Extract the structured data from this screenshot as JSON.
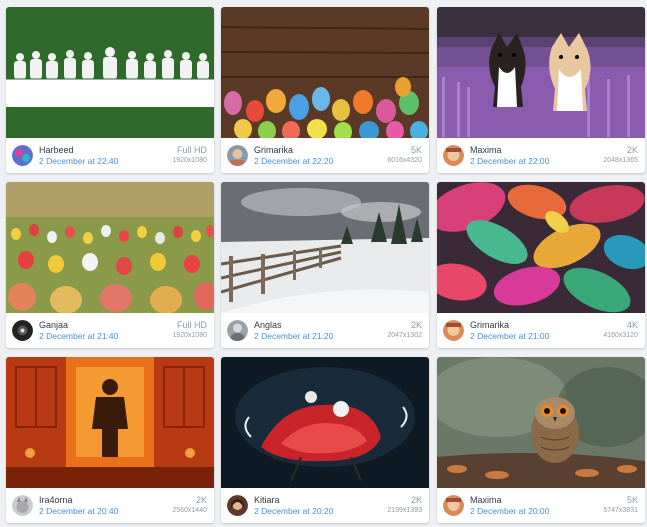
{
  "wallpapers": [
    {
      "author": "Harbeed",
      "date": "2 December at 22:40",
      "resolution_label": "Full HD",
      "dimensions": "1920x1080",
      "thumbnail": "last-supper-icon",
      "avatar": "colorful-avatar-icon"
    },
    {
      "author": "Grimarika",
      "date": "2 December at 22:20",
      "resolution_label": "5K",
      "dimensions": "6016x4320",
      "thumbnail": "easter-eggs-icon",
      "avatar": "person-avatar-icon"
    },
    {
      "author": "Maxima",
      "date": "2 December at 22:00",
      "resolution_label": "2K",
      "dimensions": "2048x1365",
      "thumbnail": "dogs-lavender-icon",
      "avatar": "face-avatar-icon"
    },
    {
      "author": "Ganjaa",
      "date": "2 December at 21:40",
      "resolution_label": "Full HD",
      "dimensions": "1920x1080",
      "thumbnail": "tulips-field-icon",
      "avatar": "dark-avatar-icon"
    },
    {
      "author": "Anglas",
      "date": "2 December at 21:20",
      "resolution_label": "2K",
      "dimensions": "2047x1302",
      "thumbnail": "snowy-fence-icon",
      "avatar": "grey-avatar-icon"
    },
    {
      "author": "Grimarika",
      "date": "2 December at 21:00",
      "resolution_label": "4K",
      "dimensions": "4160x3120",
      "thumbnail": "colorful-leaves-icon",
      "avatar": "face-avatar-icon"
    },
    {
      "author": "Ira4orna",
      "date": "2 December at 20:40",
      "resolution_label": "2K",
      "dimensions": "2560x1440",
      "thumbnail": "orange-room-man-icon",
      "avatar": "cat-avatar-icon"
    },
    {
      "author": "Kitiara",
      "date": "2 December at 20:20",
      "resolution_label": "2K",
      "dimensions": "2199x1393",
      "thumbnail": "red-creature-icon",
      "avatar": "woman-avatar-icon"
    },
    {
      "author": "Maxima",
      "date": "2 December at 20:00",
      "resolution_label": "5K",
      "dimensions": "5747x3831",
      "thumbnail": "owl-icon",
      "avatar": "face-avatar-icon"
    }
  ],
  "colors": {
    "background": "#eef0f3",
    "card": "#ffffff",
    "author_text": "#333a42",
    "date_link": "#4a90d9",
    "muted": "#8e9aa6"
  }
}
